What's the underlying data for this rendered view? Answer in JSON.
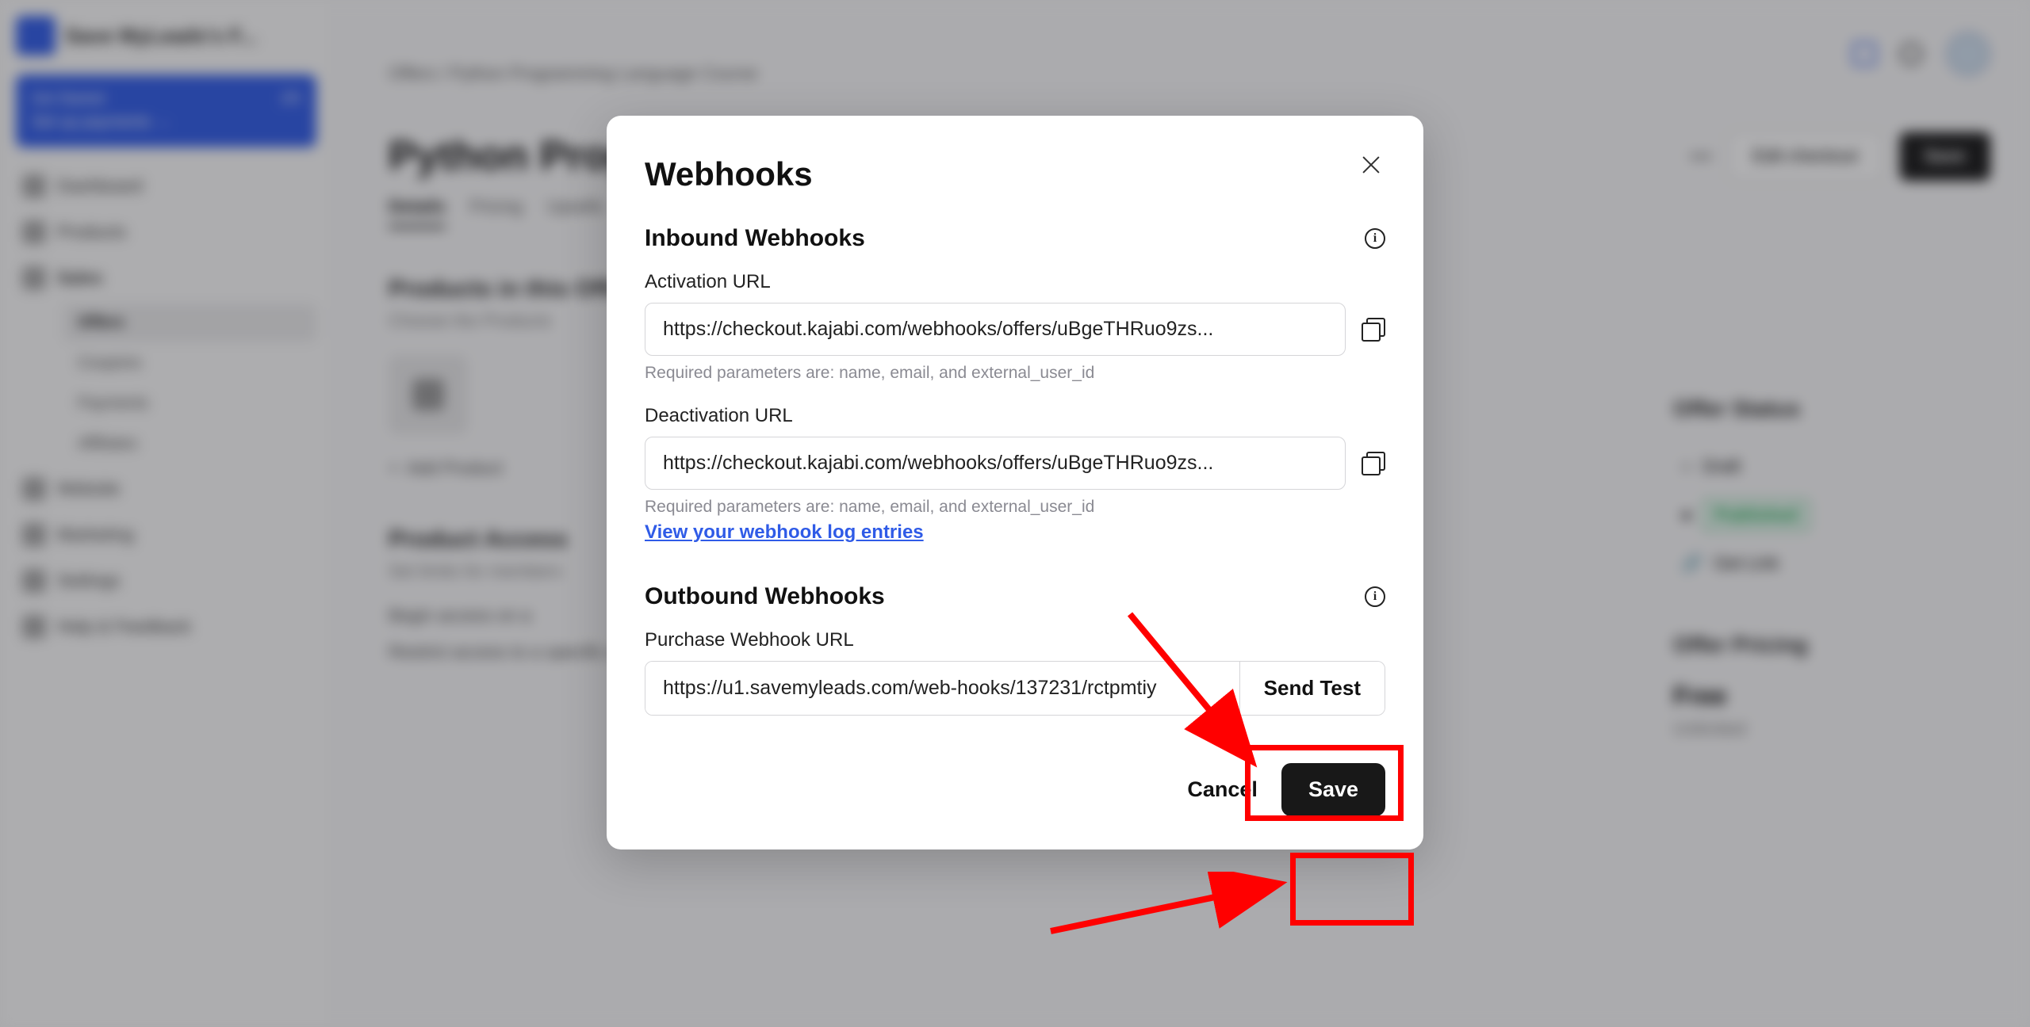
{
  "app": {
    "title": "Save MyLeads's F..."
  },
  "banner": {
    "label": "Get Started",
    "progress": "2/5",
    "text": "Set up payments →"
  },
  "nav": {
    "dashboard": "Dashboard",
    "products": "Products",
    "sales": "Sales",
    "website": "Website",
    "marketing": "Marketing",
    "settings": "Settings",
    "help": "Help & Feedback"
  },
  "subnav": {
    "offers": "Offers",
    "coupons": "Coupons",
    "payments": "Payments",
    "affiliates": "Affiliates"
  },
  "breadcrumb": {
    "offers": "Offers",
    "sep": "/",
    "item": "Python Programming Language Course"
  },
  "page": {
    "title": "Python Programming Language Course"
  },
  "head_actions": {
    "edit": "Edit checkout",
    "save": "Save"
  },
  "tabs": {
    "details": "Details",
    "pricing": "Pricing",
    "upsells": "Upsells"
  },
  "products_section": {
    "title": "Products in this Offer",
    "desc": "Choose the Products",
    "add": "Add Product"
  },
  "access_section": {
    "title": "Product Access",
    "desc": "Set limits for members",
    "begin": "Begin access on a",
    "restrict": "Restrict access to a specific amount of days"
  },
  "offer_status": {
    "title": "Offer Status",
    "draft": "Draft",
    "published": "Published",
    "getlink": "Get Link"
  },
  "pricing_section": {
    "title": "Offer Pricing",
    "free": "Free",
    "unlimited": "Unlimited"
  },
  "modal": {
    "title": "Webhooks",
    "inbound": "Inbound Webhooks",
    "activation_label": "Activation URL",
    "activation_url": "https://checkout.kajabi.com/webhooks/offers/uBgeTHRuo9zs...",
    "deactivation_label": "Deactivation URL",
    "deactivation_url": "https://checkout.kajabi.com/webhooks/offers/uBgeTHRuo9zs...",
    "hint": "Required parameters are: name, email, and external_user_id",
    "view_log": "View your webhook log entries",
    "outbound": "Outbound Webhooks",
    "purchase_label": "Purchase Webhook URL",
    "purchase_url": "https://u1.savemyleads.com/web-hooks/137231/rctpmtiy",
    "send_test": "Send Test",
    "cancel": "Cancel",
    "save": "Save"
  }
}
